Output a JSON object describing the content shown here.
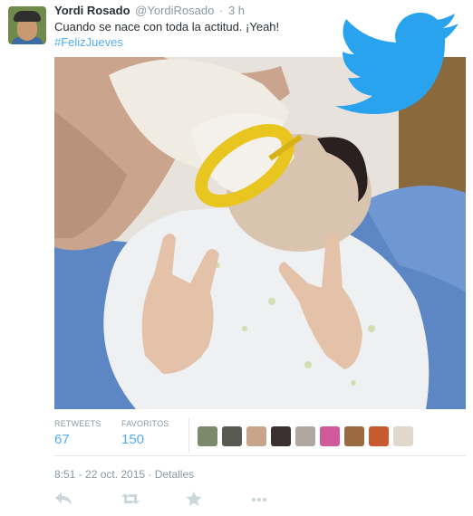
{
  "tweet": {
    "author_name": "Yordi Rosado",
    "author_handle": "@YordiRosado",
    "separator": "·",
    "time_ago": "3 h",
    "text": "Cuando se nace con toda la actitud. ¡Yeah!",
    "hashtag": "#FelizJueves",
    "timestamp": "8:51 - 22 oct. 2015",
    "details_link": "Detalles"
  },
  "stats": {
    "retweets_label": "RETWEETS",
    "retweets_value": "67",
    "favorites_label": "FAVORITOS",
    "favorites_value": "150"
  },
  "favoriter_avatar_colors": [
    "#7a8a6a",
    "#5a5a55",
    "#c8a58a",
    "#3a3030",
    "#b0a8a0",
    "#d05a9a",
    "#9a6a40",
    "#c85a30",
    "#e0d8cc"
  ],
  "colors": {
    "link": "#55acee",
    "muted": "#8899a6",
    "text": "#292f33",
    "twitter_blue": "#2aa3ef"
  },
  "icons": {
    "bird": "twitter-bird-icon",
    "reply": "reply-icon",
    "retweet": "retweet-icon",
    "favorite": "star-icon",
    "more": "more-dots-icon"
  }
}
